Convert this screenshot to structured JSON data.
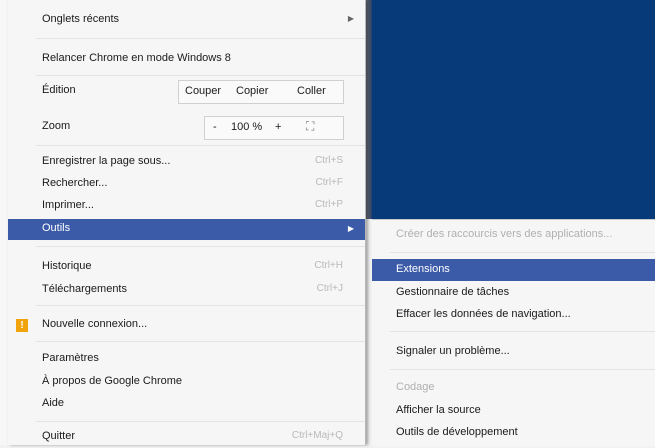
{
  "colors": {
    "desktop_bg": "#063a78",
    "highlight": "#3b5ba9",
    "disabled_text": "#b0b0b0",
    "warning": "#f0a30a"
  },
  "menu": {
    "recent_tabs": "Onglets récents",
    "relaunch_win8": "Relancer Chrome en mode Windows 8",
    "edit_label": "Édition",
    "cut": "Couper",
    "copy": "Copier",
    "paste": "Coller",
    "zoom_label": "Zoom",
    "zoom_minus": "-",
    "zoom_value": "100 %",
    "zoom_plus": "+",
    "fullscreen_icon": "fullscreen-icon",
    "save_page": "Enregistrer la page sous...",
    "save_page_shortcut": "Ctrl+S",
    "find": "Rechercher...",
    "find_shortcut": "Ctrl+F",
    "print": "Imprimer...",
    "print_shortcut": "Ctrl+P",
    "tools": "Outils",
    "history": "Historique",
    "history_shortcut": "Ctrl+H",
    "downloads": "Téléchargements",
    "downloads_shortcut": "Ctrl+J",
    "warning_icon": "warning-icon",
    "new_connection": "Nouvelle connexion...",
    "settings": "Paramètres",
    "about": "À propos de Google Chrome",
    "help": "Aide",
    "quit": "Quitter",
    "quit_shortcut": "Ctrl+Maj+Q"
  },
  "submenu": {
    "create_shortcuts": "Créer des raccourcis vers des applications...",
    "extensions": "Extensions",
    "task_manager": "Gestionnaire de tâches",
    "clear_data": "Effacer les données de navigation...",
    "report_problem": "Signaler un problème...",
    "encoding": "Codage",
    "view_source": "Afficher la source",
    "dev_tools": "Outils de développement"
  }
}
